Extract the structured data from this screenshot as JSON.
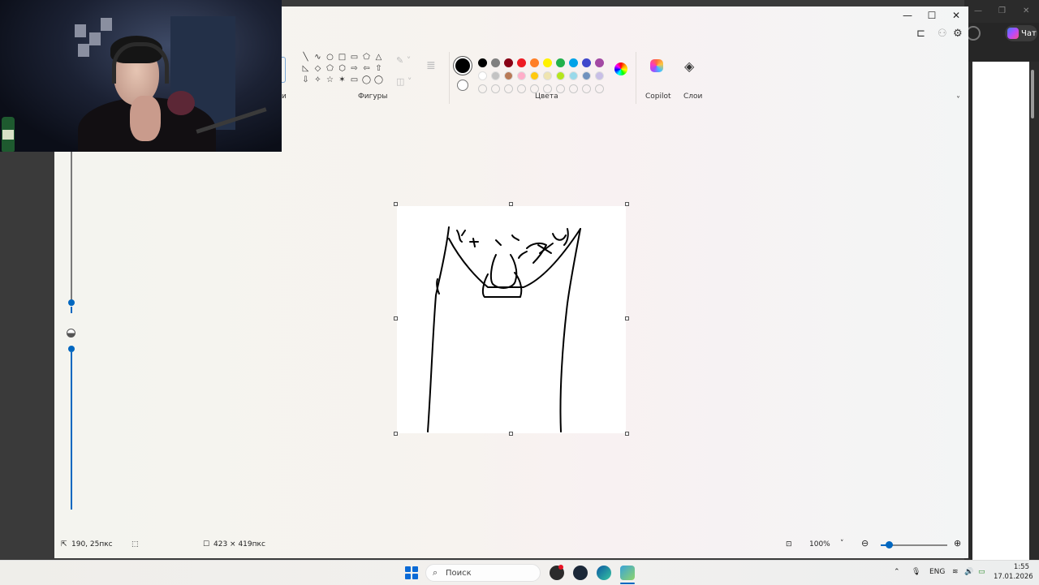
{
  "background_browser": {
    "chat_label": "Чат"
  },
  "paint": {
    "ribbon": {
      "shapes_label": "Фигуры",
      "colors_label": "Цвета",
      "copilot_label": "Copilot",
      "layers_label": "Слои",
      "partial_label": "и",
      "current_color": "#000000",
      "palette_row1": [
        "#000000",
        "#7f7f7f",
        "#880015",
        "#ed1c24",
        "#ff7f27",
        "#fff200",
        "#22b14c",
        "#00a2e8",
        "#3f48cc",
        "#a349a4"
      ],
      "palette_row2": [
        "#ffffff",
        "#c3c3c3",
        "#b97a57",
        "#ffaec9",
        "#ffc90e",
        "#efe4b0",
        "#b5e61d",
        "#99d9ea",
        "#7092be",
        "#c8bfe7"
      ],
      "shape_icons": [
        "╲",
        "∿",
        "○",
        "□",
        "▭",
        "⬠",
        "△",
        "◺",
        "◇",
        "⬠",
        "⬡",
        "⇨",
        "⇦",
        "⇧",
        "⇩",
        "✧",
        "☆",
        "✶",
        "▭",
        "◯",
        "◯"
      ]
    },
    "status": {
      "cursor_position": "190, 25пкс",
      "canvas_size": "423 × 419пкс",
      "zoom": "100%"
    }
  },
  "taskbar": {
    "search_placeholder": "Поиск",
    "language": "ENG",
    "time": "1:55",
    "date": "17.01.2026"
  }
}
